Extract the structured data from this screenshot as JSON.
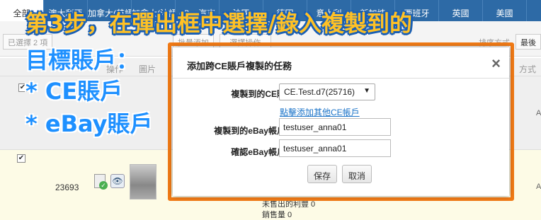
{
  "tabs": [
    "全部",
    "澳大利亞",
    "加拿大(英語)",
    "加拿大(法語)",
    "eBay汽車",
    "法國",
    "德國",
    "意大利",
    "新加坡",
    "西班牙",
    "英國",
    "美國"
  ],
  "toolbar": {
    "selected_count": "已選擇 2 項",
    "batch_add": "批量添加",
    "batch_ops": "--選擇操作--",
    "sort_label": "排序方式",
    "sort_value": "最後"
  },
  "table": {
    "headers": [
      "操作",
      "圖片",
      "方式"
    ],
    "row": {
      "order_id": "23693",
      "unsold": "未售出的利豐 0",
      "sales": "銷售量 0",
      "edge": "A"
    }
  },
  "annotation": {
    "line1": "第3步，在彈出框中選擇/錄入複製到的",
    "line2": "目標賬戶：",
    "line3": "* CE賬戶",
    "line4": "* eBay賬戶"
  },
  "dialog": {
    "title": "添加跨CE賬戶複製的任務",
    "close": "×",
    "ce_label": "複製到的CE賬戶：",
    "ce_value": "CE.Test.d7(25716)",
    "add_ce_link": "點擊添加其他CE帳戶",
    "ebay_label": "複製到的eBay帳戶名：",
    "ebay_value": "testuser_anna01",
    "confirm_label": "確認eBay帳戶名：",
    "confirm_value": "testuser_anna01",
    "save": "保存",
    "cancel": "取消"
  },
  "colors": {
    "tab_bar": "#2d6aa6",
    "highlight": "#f07a16",
    "annotation_yellow": "#ffc125",
    "annotation_blue": "#1e90ff",
    "link": "#1a73c8"
  }
}
